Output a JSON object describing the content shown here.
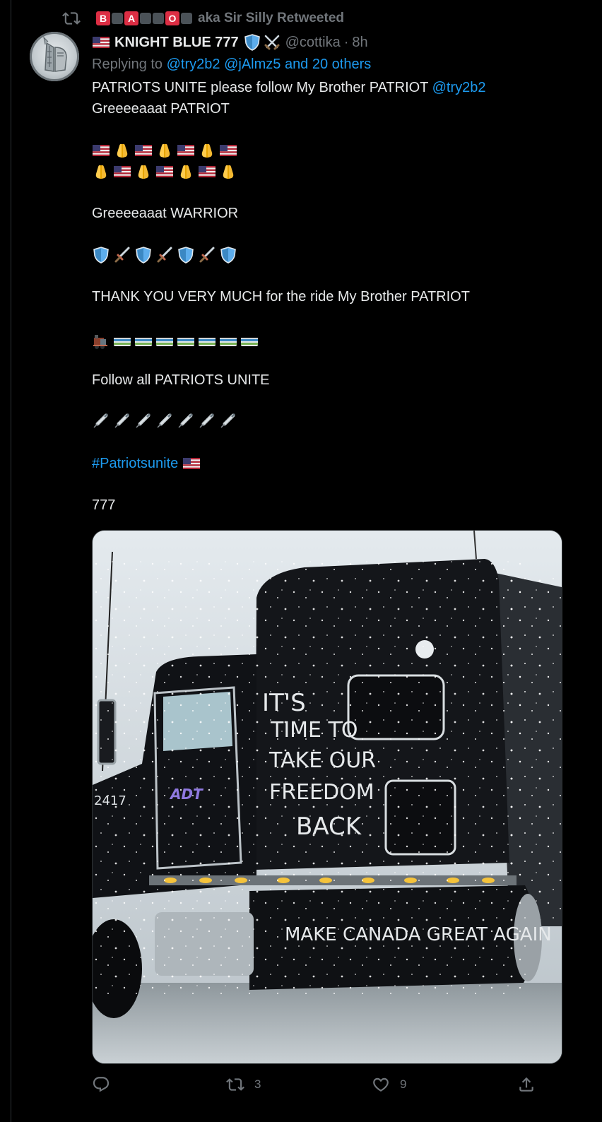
{
  "retweet": {
    "label": "aka Sir Silly Retweeted",
    "badges": [
      "B",
      "A",
      "O"
    ]
  },
  "author": {
    "name": "KNIGHT BLUE 777",
    "handle": "@cottika",
    "separator": "·",
    "time": "8h"
  },
  "reply": {
    "prefix": "Replying to",
    "targets": "@try2b2 @jAlmz5 and 20 others"
  },
  "text": {
    "l1": "PATRIOTS UNITE please follow My Brother PATRIOT",
    "l1_mention": "@try2b2",
    "l2": "Greeeeaaat PATRIOT",
    "l3": "Greeeeaaat WARRIOR",
    "l4": "THANK YOU VERY MUCH for the ride My Brother PATRIOT",
    "l5": "Follow all PATRIOTS UNITE",
    "hashtag": "#Patriotsunite",
    "l6": "777"
  },
  "media": {
    "truck_lettering": {
      "line1": "IT'S",
      "line2": "TIME TO",
      "line3": "TAKE OUR",
      "line4": "FREEDOM",
      "line5": "BACK",
      "fairing": "MAKE CANADA GREAT AGAIN",
      "door_logo": "ADT",
      "number": "2417"
    }
  },
  "actions": {
    "reply_count": "",
    "retweet_count": "3",
    "like_count": "9"
  },
  "colors": {
    "background": "#000000",
    "text": "#e7e9ea",
    "muted": "#71767b",
    "accent": "#1d9bf0"
  }
}
